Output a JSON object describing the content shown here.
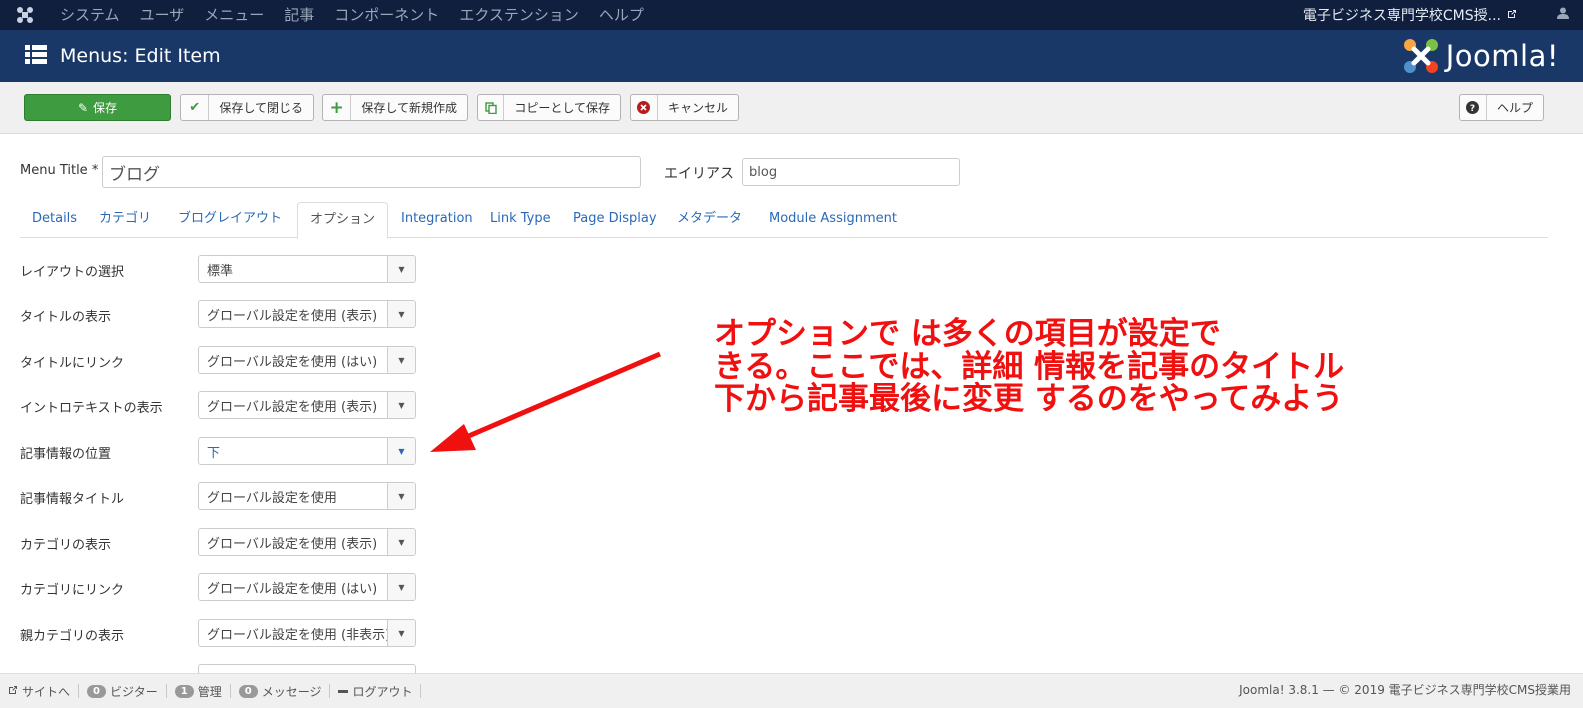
{
  "topnav": {
    "menu": [
      "システム",
      "ユーザ",
      "メニュー",
      "記事",
      "コンポーネント",
      "エクステンション",
      "ヘルプ"
    ],
    "site_name": "電子ビジネス専門学校CMS授...",
    "icons": {
      "logo": "joomla-icon",
      "external": "external-link-icon",
      "user": "user-icon"
    }
  },
  "header": {
    "title": "Menus: Edit Item",
    "brand": "Joomla!"
  },
  "toolbar": {
    "save": "保存",
    "save_close": "保存して閉じる",
    "save_new": "保存して新規作成",
    "save_copy": "コピーとして保存",
    "cancel": "キャンセル",
    "help": "ヘルプ"
  },
  "form": {
    "menu_title_label": "Menu Title *",
    "menu_title_value": "ブログ",
    "alias_label": "エイリアス",
    "alias_value": "blog"
  },
  "tabs": [
    "Details",
    "カテゴリ",
    "ブログレイアウト",
    "オプション",
    "Integration",
    "Link Type",
    "Page Display",
    "メタデータ",
    "Module Assignment"
  ],
  "active_tab": "オプション",
  "options": [
    {
      "label": "レイアウトの選択",
      "value": "標準"
    },
    {
      "label": "タイトルの表示",
      "value": "グローバル設定を使用 (表示)"
    },
    {
      "label": "タイトルにリンク",
      "value": "グローバル設定を使用 (はい)"
    },
    {
      "label": "イントロテキストの表示",
      "value": "グローバル設定を使用 (表示)"
    },
    {
      "label": "記事情報の位置",
      "value": "下"
    },
    {
      "label": "記事情報タイトル",
      "value": "グローバル設定を使用"
    },
    {
      "label": "カテゴリの表示",
      "value": "グローバル設定を使用 (表示)"
    },
    {
      "label": "カテゴリにリンク",
      "value": "グローバル設定を使用 (はい)"
    },
    {
      "label": "親カテゴリの表示",
      "value": "グローバル設定を使用 (非表示)"
    }
  ],
  "annotation": "オプションで は多くの項目が設定で\nきる。ここでは、詳細 情報を記事のタイトル\n下から記事最後に変更 するのをやってみよう",
  "annotation_color": "#f01010",
  "footer": {
    "site_link": "サイトへ",
    "visitors_count": "0",
    "visitors_label": "ビジター",
    "admin_count": "1",
    "admin_label": "管理",
    "messages_count": "0",
    "messages_label": "メッセージ",
    "logout": "ログアウト",
    "copyright": "Joomla! 3.8.1 — © 2019 電子ビジネス専門学校CMS授業用"
  }
}
